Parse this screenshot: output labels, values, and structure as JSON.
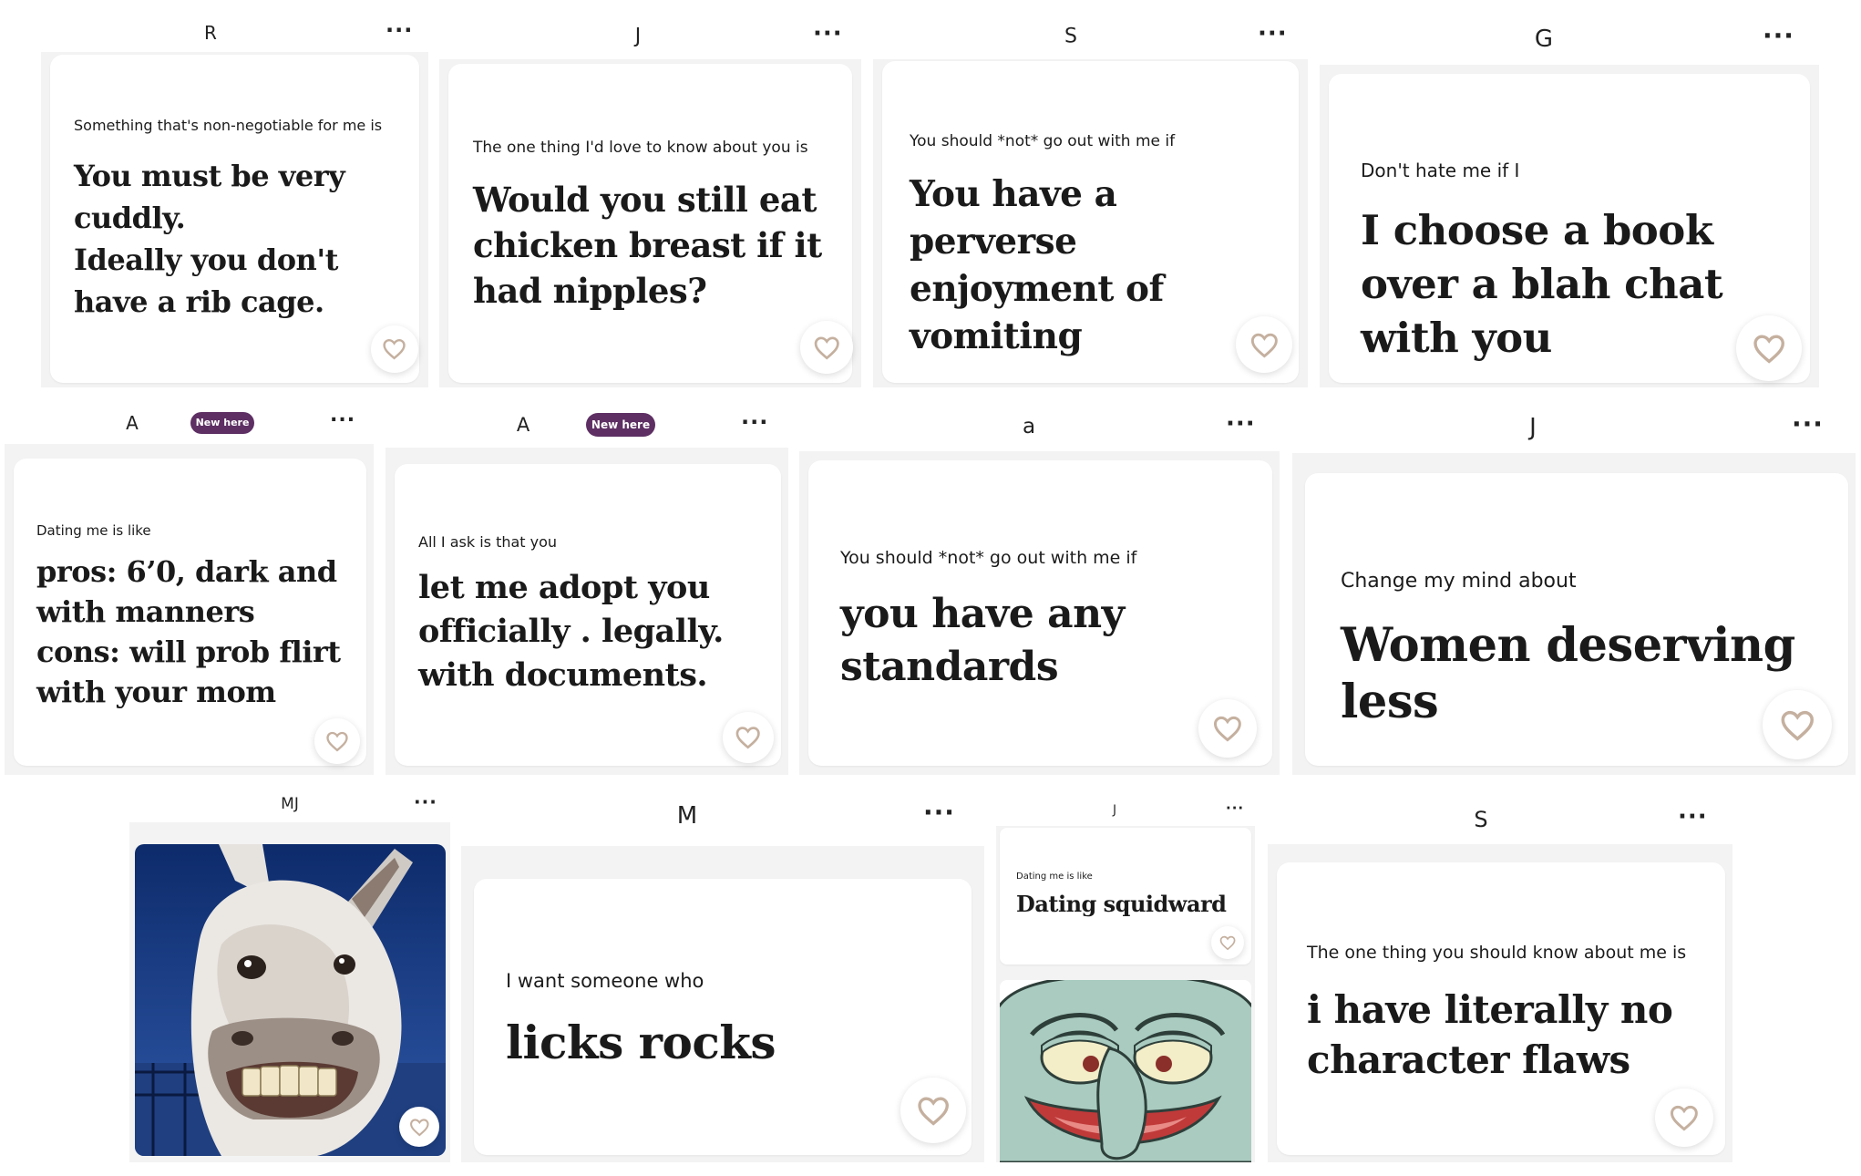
{
  "profiles": [
    {
      "name": "R",
      "prompt": "Something that's non-negotiable for me is",
      "answer": "You must be very cuddly.\nIdeally you don't have a rib cage."
    },
    {
      "name": "J",
      "prompt": "The one thing I'd love to know about you is",
      "answer": "Would you still eat chicken breast if it had nipples?"
    },
    {
      "name": "S",
      "prompt": "You should *not* go out with me if",
      "answer": "You have a perverse enjoyment of vomiting"
    },
    {
      "name": "G",
      "prompt": "Don't hate me if I",
      "answer": "I choose a book over a blah chat with you"
    },
    {
      "name": "A",
      "badge": "New here",
      "prompt": "Dating me is like",
      "answer": "pros: 6’0, dark and with manners\ncons: will prob flirt with your mom"
    },
    {
      "name": "A",
      "badge": "New here",
      "prompt": "All I ask is that you",
      "answer": "let me adopt you officially . legally. with documents."
    },
    {
      "name": "a",
      "prompt": "You should *not* go out with me if",
      "answer": "you have any standards"
    },
    {
      "name": "J",
      "prompt": "Change my mind about",
      "answer": "Women deserving less"
    },
    {
      "name": "MJ",
      "photo": "smiling-donkey-photo"
    },
    {
      "name": "M",
      "prompt": "I want someone who",
      "answer": "licks rocks"
    },
    {
      "name": "J",
      "prompt": "Dating me is like",
      "answer": "Dating squidward",
      "photo": "squidward-face-photo"
    },
    {
      "name": "S",
      "prompt": "The one thing you should know about me is",
      "answer": "i have literally no character flaws"
    }
  ],
  "menu_icon": "more-options-dots-icon",
  "like_icon": "heart-icon",
  "colors": {
    "badge": "#5d2f63",
    "heart": "#c5b09f",
    "panel": "#f3f3f3",
    "card": "#ffffff"
  }
}
